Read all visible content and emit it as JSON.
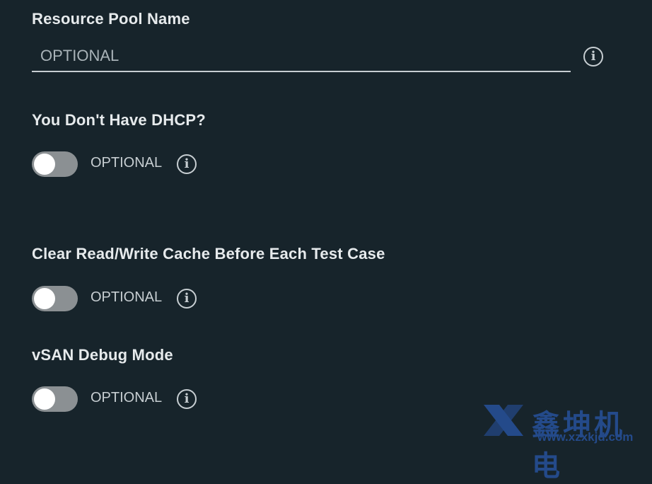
{
  "fields": {
    "resource_pool": {
      "label": "Resource Pool Name",
      "placeholder": "OPTIONAL",
      "value": ""
    },
    "no_dhcp": {
      "label": "You Don't Have DHCP?",
      "toggle_text": "OPTIONAL",
      "enabled": false
    },
    "clear_cache": {
      "label": "Clear Read/Write Cache Before Each Test Case",
      "toggle_text": "OPTIONAL",
      "enabled": false
    },
    "vsan_debug": {
      "label": "vSAN Debug Mode",
      "toggle_text": "OPTIONAL",
      "enabled": false
    }
  },
  "icons": {
    "info_glyph": "i"
  },
  "colors": {
    "background": "#17242b",
    "text": "#e6eaec",
    "muted_text": "#c7ced2",
    "toggle_off": "#8b9093",
    "watermark": "#2f6ad8"
  },
  "watermark": {
    "name": "鑫坤机电",
    "url": "www.xzxkjd.com"
  }
}
